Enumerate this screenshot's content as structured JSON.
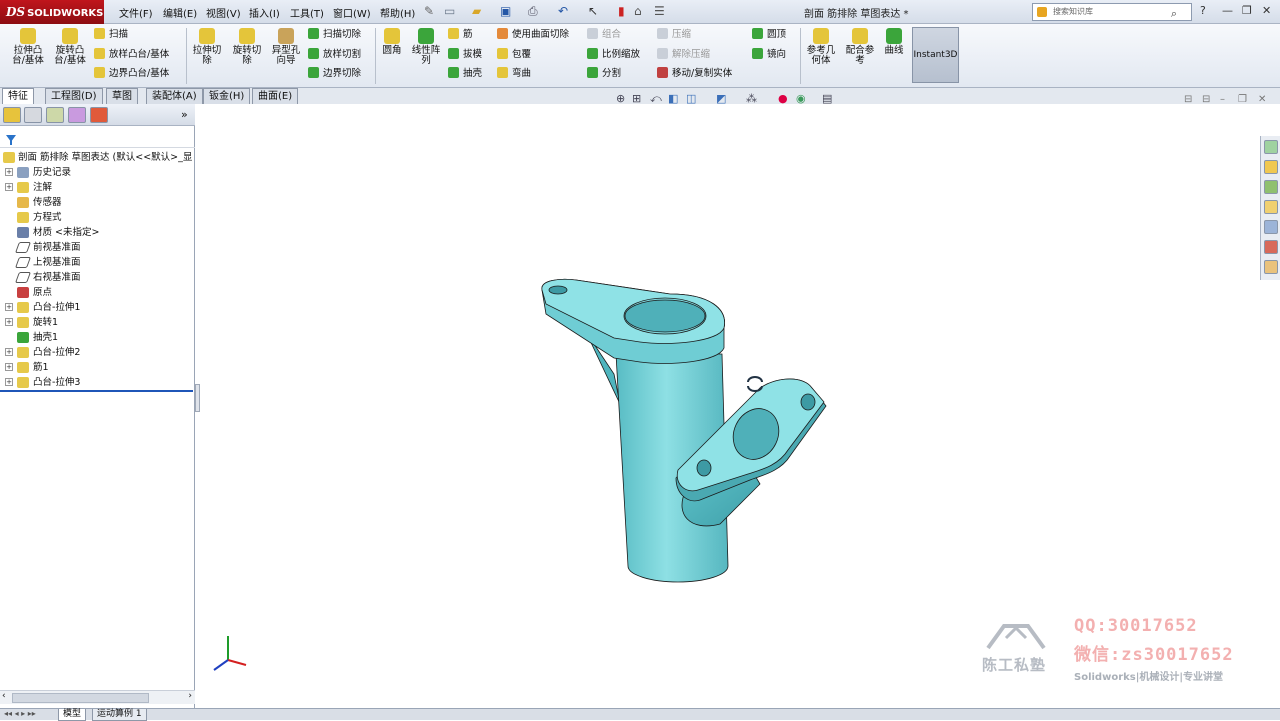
{
  "app": {
    "logo": "SOLIDWORKS",
    "logo_prefix": "DS",
    "document_title": "剖面 筋排除 草图表达 *",
    "search_placeholder": "搜索知识库"
  },
  "menu": [
    "文件(F)",
    "编辑(E)",
    "视图(V)",
    "插入(I)",
    "工具(T)",
    "窗口(W)",
    "帮助(H)"
  ],
  "commands": {
    "extrude_boss": "拉伸凸\n台/基体",
    "revolve_boss": "旋转凸\n台/基体",
    "sweep": "扫描",
    "loft_boss": "放样凸台/基体",
    "boundary_boss": "边界凸台/基体",
    "extrude_cut": "拉伸切\n除",
    "revolve_cut": "旋转切\n除",
    "hole_wizard": "异型孔\n向导",
    "swept_cut": "扫描切除",
    "lofted_cut": "放样切割",
    "boundary_cut": "边界切除",
    "fillet": "圆角",
    "linear_pattern": "线性阵\n列",
    "rib": "筋",
    "draft": "拔模",
    "shell": "抽壳",
    "use_surface_cut": "使用曲面切除",
    "wrap": "包覆",
    "flex": "弯曲",
    "combine": "组合",
    "scale": "比例缩放",
    "split": "分割",
    "indent": "压缩",
    "delete_body": "解除压缩",
    "move_copy_body": "移动/复制实体",
    "dome": "圆顶",
    "mirror": "镜向",
    "reference_geometry": "参考几\n何体",
    "mate_reference": "配合参\n考",
    "curves": "曲线",
    "instant3d": "Instant3D"
  },
  "tabs": [
    "特征",
    "工程图(D)",
    "草图",
    "装配体(A)",
    "钣金(H)",
    "曲面(E)"
  ],
  "active_tab": "特征",
  "feature_tree": {
    "root": "剖面 筋排除 草图表达  (默认<<默认>_显",
    "items": [
      {
        "label": "历史记录",
        "icon": "history-icon",
        "expandable": true
      },
      {
        "label": "注解",
        "icon": "annotation-icon",
        "expandable": true
      },
      {
        "label": "传感器",
        "icon": "sensor-icon",
        "expandable": false
      },
      {
        "label": "方程式",
        "icon": "equation-icon",
        "expandable": false
      },
      {
        "label": "材质 <未指定>",
        "icon": "material-icon",
        "expandable": false
      },
      {
        "label": "前视基准面",
        "icon": "plane-icon",
        "expandable": false
      },
      {
        "label": "上视基准面",
        "icon": "plane-icon",
        "expandable": false
      },
      {
        "label": "右视基准面",
        "icon": "plane-icon",
        "expandable": false
      },
      {
        "label": "原点",
        "icon": "origin-icon",
        "expandable": false
      },
      {
        "label": "凸台-拉伸1",
        "icon": "extrude-icon",
        "expandable": true
      },
      {
        "label": "旋转1",
        "icon": "revolve-icon",
        "expandable": true
      },
      {
        "label": "抽壳1",
        "icon": "shell-icon",
        "expandable": false
      },
      {
        "label": "凸台-拉伸2",
        "icon": "extrude-icon",
        "expandable": true
      },
      {
        "label": "筋1",
        "icon": "rib-icon",
        "expandable": true
      },
      {
        "label": "凸台-拉伸3",
        "icon": "extrude-icon",
        "expandable": true
      }
    ]
  },
  "bottom_tabs": [
    "模型",
    "运动算例 1"
  ],
  "watermark": {
    "qq": "QQ:30017652",
    "wechat": "微信:zs30017652",
    "subtitle": "Solidworks|机械设计|专业讲堂",
    "studio": "陈工私塾"
  },
  "colors": {
    "part": "#7fd6dc",
    "part_shade": "#4fb5be",
    "edge": "#1a1a1a",
    "brand": "#b3121a",
    "selection": "#1f56b8"
  }
}
